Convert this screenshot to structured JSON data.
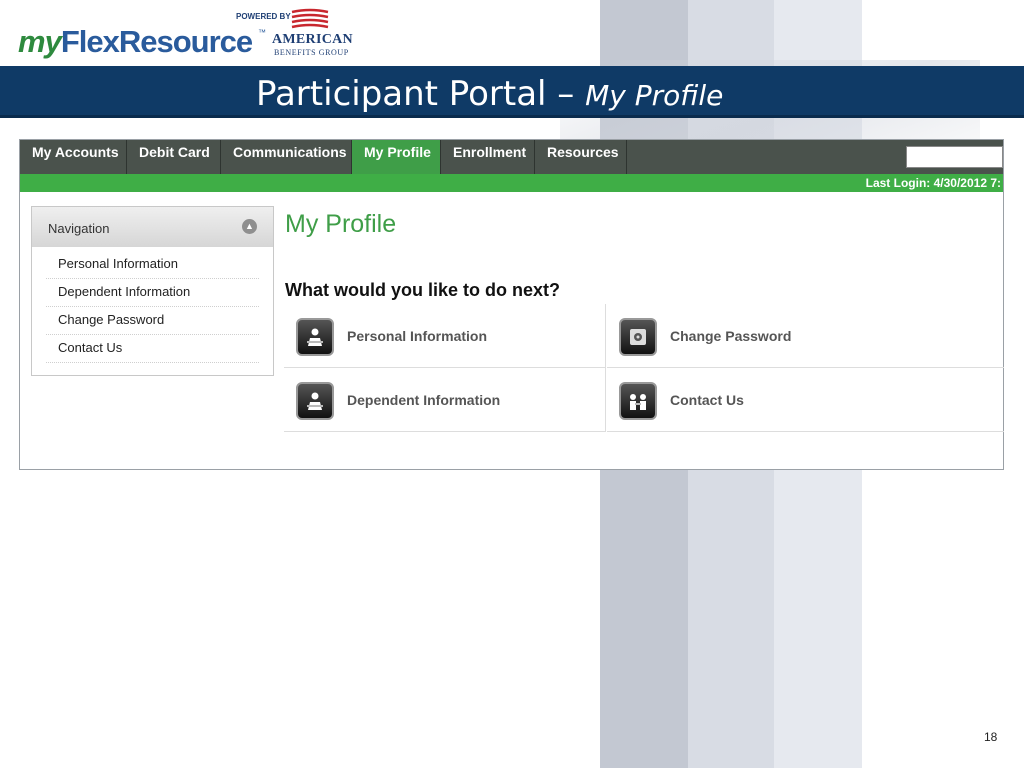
{
  "logo": {
    "brand_my": "my",
    "brand_rest": "FlexResource",
    "trademark": "™",
    "powered_by": "POWERED BY",
    "abg_line1": "AMERICAN",
    "abg_line2": "BENEFITS GROUP"
  },
  "slide": {
    "title": "Participant Portal – ",
    "title_italic": "My Profile",
    "page_number": "18"
  },
  "tabs": [
    {
      "label": "My Accounts"
    },
    {
      "label": "Debit Card"
    },
    {
      "label": "Communications"
    },
    {
      "label": "My Profile",
      "active": true
    },
    {
      "label": "Enrollment"
    },
    {
      "label": "Resources"
    }
  ],
  "last_login": "Last Login: 4/30/2012 7:",
  "navigation": {
    "title": "Navigation",
    "items": [
      {
        "label": "Personal Information"
      },
      {
        "label": "Dependent Information"
      },
      {
        "label": "Change Password"
      },
      {
        "label": "Contact Us"
      }
    ]
  },
  "main": {
    "heading": "My Profile",
    "subheading": "What would you like to do next?",
    "options": [
      {
        "label": "Personal Information",
        "icon": "person-at-desk-icon"
      },
      {
        "label": "Change Password",
        "icon": "safe-lock-icon"
      },
      {
        "label": "Dependent Information",
        "icon": "person-at-desk-icon"
      },
      {
        "label": "Contact Us",
        "icon": "people-talking-icon"
      }
    ]
  },
  "colors": {
    "title_bar": "#0f3a66",
    "tab_bar": "#4a524c",
    "active_tab": "#3f9e48",
    "green_bar": "#3fae46",
    "heading_green": "#3f9e48"
  }
}
